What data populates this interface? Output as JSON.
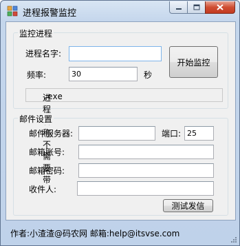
{
  "window": {
    "title": "进程报警监控",
    "icon": "app-grid-icon",
    "controls": [
      "minimize-icon",
      "maximize-icon",
      "close-icon"
    ]
  },
  "monitor": {
    "group_title": "监控进程",
    "process_name_label": "进程名字:",
    "process_name_value": "",
    "start_button": "开始监控",
    "frequency_label": "频率:",
    "frequency_value": "30",
    "frequency_unit": "秒",
    "hint_prefix": "进程名称不需要带",
    "hint_suffix": ".exe"
  },
  "mail": {
    "group_title": "邮件设置",
    "server_label": "邮件服务器:",
    "server_value": "",
    "port_label": "端口:",
    "port_value": "25",
    "account_label": "邮箱账号:",
    "account_value": "",
    "password_label": "邮箱密码:",
    "password_value": "",
    "recipient_label": "收件人:",
    "recipient_value": "",
    "test_button": "测试发信"
  },
  "status": {
    "text": "作者:小渣渣@码农网   邮箱:help@itsvse.com"
  },
  "colors": {
    "titlebar": "#c4d6ec",
    "client": "#f0f0f0",
    "close_button": "#c23a20",
    "focus_border": "#7eb4ea"
  }
}
